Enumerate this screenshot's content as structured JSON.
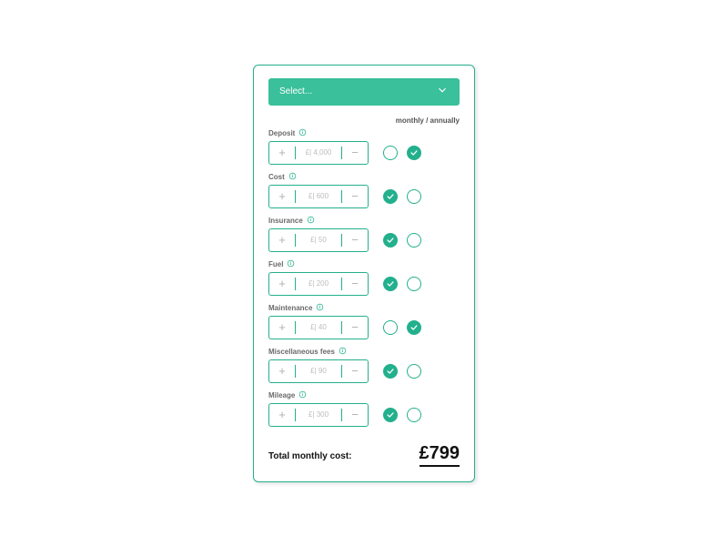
{
  "select": {
    "placeholder": "Select..."
  },
  "header": {
    "frequency": "monthly / annually"
  },
  "currency_prefix": "£| ",
  "rows": [
    {
      "key": "deposit",
      "label": "Deposit",
      "value": "4,000",
      "monthly": false,
      "annually": true
    },
    {
      "key": "cost",
      "label": "Cost",
      "value": "600",
      "monthly": true,
      "annually": false
    },
    {
      "key": "insurance",
      "label": "Insurance",
      "value": "50",
      "monthly": true,
      "annually": false
    },
    {
      "key": "fuel",
      "label": "Fuel",
      "value": "200",
      "monthly": true,
      "annually": false
    },
    {
      "key": "maintenance",
      "label": "Maintenance",
      "value": "40",
      "monthly": false,
      "annually": true
    },
    {
      "key": "misc",
      "label": "Miscellaneous fees",
      "value": "90",
      "monthly": true,
      "annually": false
    },
    {
      "key": "mileage",
      "label": "Mileage",
      "value": "300",
      "monthly": true,
      "annually": false
    }
  ],
  "total": {
    "label": "Total monthly cost:",
    "value": "£799"
  },
  "colors": {
    "accent": "#23b08c"
  }
}
